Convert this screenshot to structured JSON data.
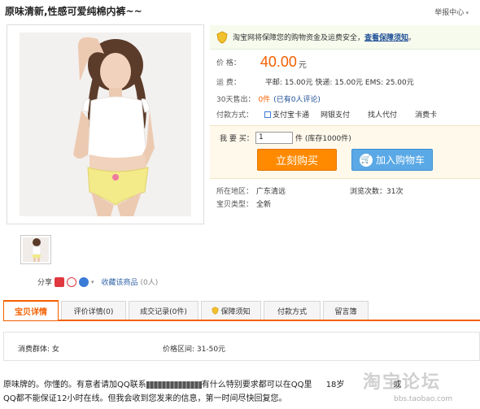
{
  "page": {
    "title": "原味清新,性感可爱纯棉内裤~~",
    "report_link": "举报中心"
  },
  "safety_notice": {
    "text": "淘宝网将保障您的购物资金及运费安全，",
    "link": "查看保障须知",
    "end": "。"
  },
  "price": {
    "label": "价    格：",
    "value": "40.00",
    "unit": "元"
  },
  "shipping": {
    "label": "运    费：",
    "value": "平邮: 15.00元 快递: 15.00元 EMS: 25.00元"
  },
  "sales": {
    "label": "30天售出：",
    "count": "0件",
    "reviews": "(已有0人评论)"
  },
  "payment": {
    "label": "付款方式：",
    "methods": [
      "支付宝卡通",
      "网银支付",
      "找人代付",
      "消费卡"
    ]
  },
  "buy": {
    "qty_label": "我 要 买：",
    "qty_value": "1",
    "stock": "件 (库存1000件)",
    "buy_now": "立刻购买",
    "add_cart": "加入购物车"
  },
  "location": {
    "label": "所在地区：",
    "value": "广东清远"
  },
  "views": "浏览次数：31次",
  "item_type": {
    "label": "宝贝类型：",
    "value": "全新"
  },
  "share": {
    "label": "分享",
    "favorite": "收藏该商品",
    "favorite_count": "(0人)"
  },
  "tabs": [
    {
      "label": "宝贝详情",
      "active": true
    },
    {
      "label": "评价详情(0)",
      "active": false
    },
    {
      "label": "成交记录(0件)",
      "active": false
    },
    {
      "label": "保障须知",
      "active": false
    },
    {
      "label": "付款方式",
      "active": false
    },
    {
      "label": "留言簿",
      "active": false
    }
  ],
  "attributes": {
    "group": "消费群体: 女",
    "price_range": "价格区间: 31-50元"
  },
  "description": {
    "line1_a": "原味牌的。你懂的。有意者请加QQ联系",
    "line1_b": "有什么特别要求都可以在QQ里",
    "line1_c": "18岁",
    "line1_d": "或",
    "line2": "QQ都不能保证12小时在线。但我会收到您发来的信息，第一时间尽快回复您。"
  },
  "watermark": {
    "text": "淘宝论坛",
    "sub": "bbs.taobao.com"
  },
  "colors": {
    "accent": "#f45f00",
    "buy_button": "#ff8a00",
    "cart_button": "#5aa9e6",
    "link": "#1f4f96"
  }
}
